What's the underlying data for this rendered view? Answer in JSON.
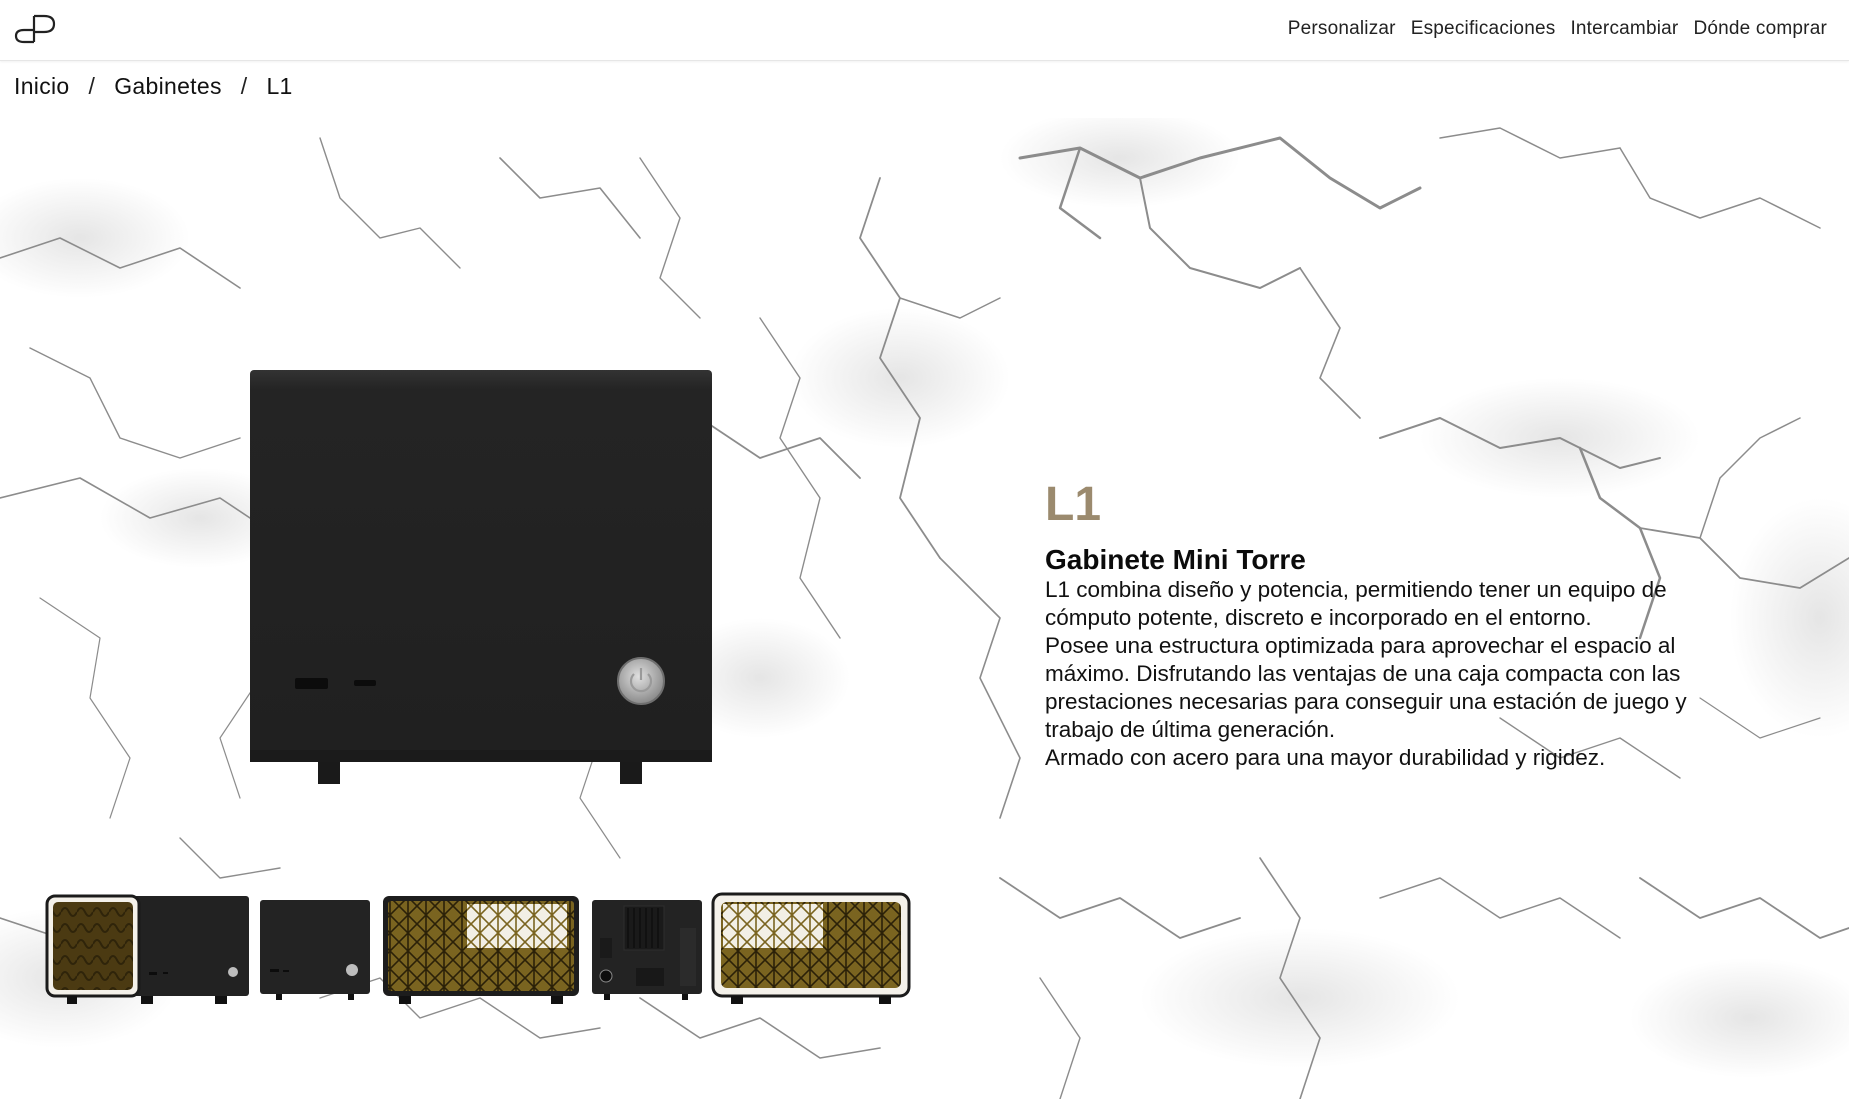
{
  "header": {
    "logo_icon": "dp-monogram-logo",
    "nav": [
      {
        "label": "Personalizar"
      },
      {
        "label": "Especificaciones"
      },
      {
        "label": "Intercambiar"
      },
      {
        "label": "Dónde comprar"
      }
    ]
  },
  "breadcrumb": {
    "items": [
      "Inicio",
      "Gabinetes",
      "L1"
    ],
    "separator": "/"
  },
  "product": {
    "name": "L1",
    "subtitle": "Gabinete Mini Torre",
    "description": [
      "L1 combina diseño y potencia, permitiendo tener un equipo de cómputo potente, discreto e incorporado en el entorno.",
      "Posee una estructura optimizada para aprovechar el espacio al máximo. Disfrutando las ventajas de una caja compacta con las prestaciones necesarias para conseguir una estación de juego y trabajo de última generación.",
      "Armado con acero para una mayor durabilidad y rigidez."
    ],
    "accent_color": "#9b8a6e",
    "thumbnails": [
      {
        "icon": "case-gold-side-panel-thumbnail"
      },
      {
        "icon": "case-black-front-thumbnail"
      },
      {
        "icon": "case-gold-lattice-thumbnail"
      },
      {
        "icon": "case-black-rear-thumbnail"
      },
      {
        "icon": "case-gold-lattice-panel-thumbnail"
      }
    ]
  }
}
